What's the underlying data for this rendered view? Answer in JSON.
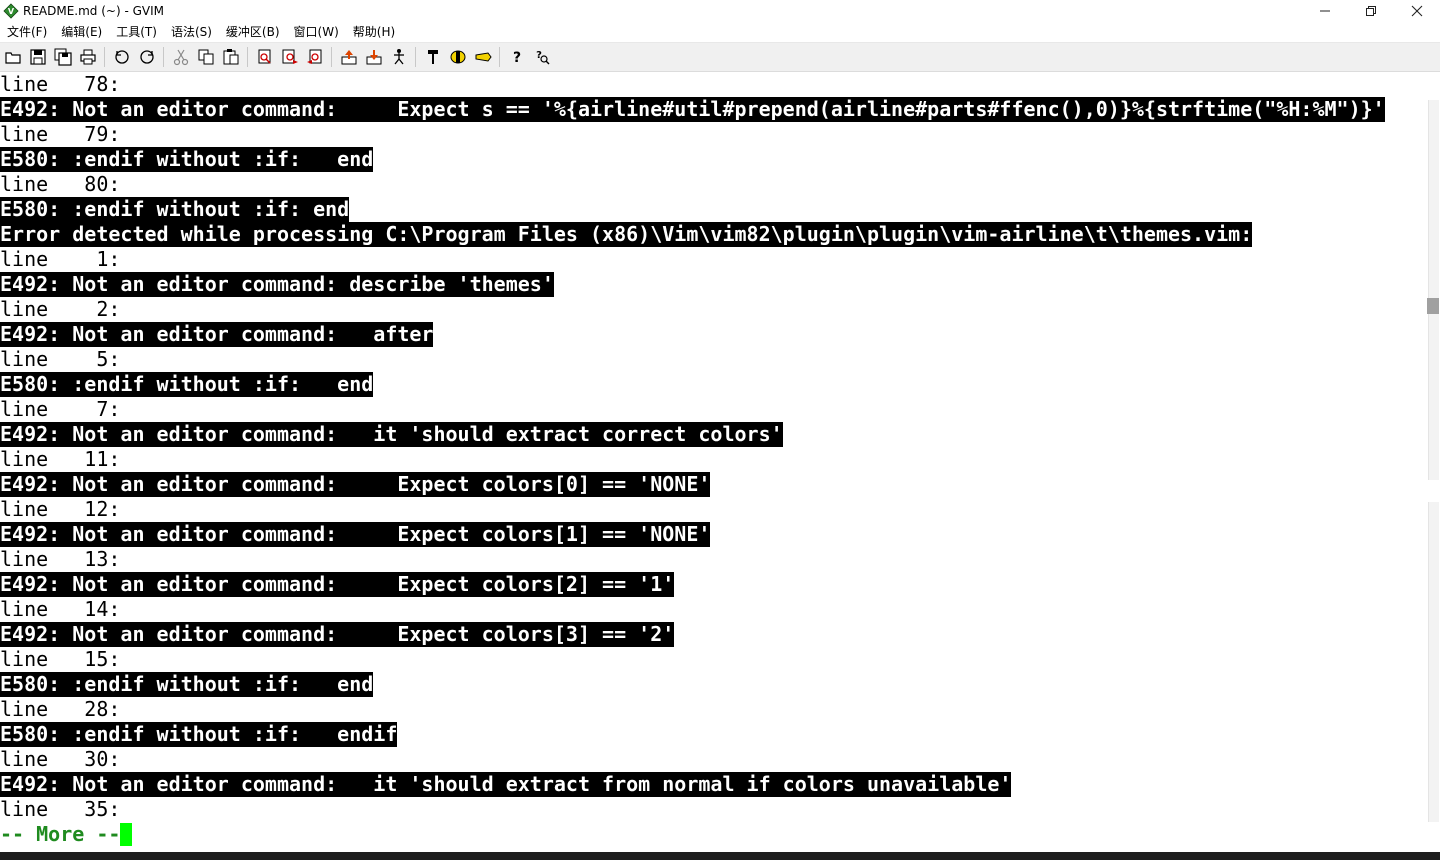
{
  "window": {
    "title": "README.md (~) - GVIM",
    "controls": {
      "minimize": "—",
      "maximize": "❐",
      "close": "✕"
    }
  },
  "menu": [
    "文件(F)",
    "编辑(E)",
    "工具(T)",
    "语法(S)",
    "缓冲区(B)",
    "窗口(W)",
    "帮助(H)"
  ],
  "toolbar": {
    "icons": [
      "open-icon",
      "save-icon",
      "save-all-icon",
      "print-icon",
      "undo-icon",
      "redo-icon",
      "cut-icon",
      "copy-icon",
      "paste-icon",
      "find-replace-icon",
      "find-next-icon",
      "find-prev-icon",
      "load-session-icon",
      "save-session-icon",
      "run-script-icon",
      "make-icon",
      "shell-icon",
      "tags-icon",
      "help-icon",
      "find-help-icon"
    ]
  },
  "editor": {
    "lines": [
      {
        "kind": "info",
        "text": "line   78:"
      },
      {
        "kind": "error",
        "text": "E492: Not an editor command:     Expect s == '%{airline#util#prepend(airline#parts#ffenc(),0)}%{strftime(\"%H:%M\")}'"
      },
      {
        "kind": "info",
        "text": "line   79:"
      },
      {
        "kind": "error",
        "text": "E580: :endif without :if:   end"
      },
      {
        "kind": "info",
        "text": "line   80:"
      },
      {
        "kind": "error",
        "text": "E580: :endif without :if: end"
      },
      {
        "kind": "error",
        "text": "Error detected while processing C:\\Program Files (x86)\\Vim\\vim82\\plugin\\plugin\\vim-airline\\t\\themes.vim:"
      },
      {
        "kind": "info",
        "text": "line    1:"
      },
      {
        "kind": "error",
        "text": "E492: Not an editor command: describe 'themes'"
      },
      {
        "kind": "info",
        "text": "line    2:"
      },
      {
        "kind": "error",
        "text": "E492: Not an editor command:   after"
      },
      {
        "kind": "info",
        "text": "line    5:"
      },
      {
        "kind": "error",
        "text": "E580: :endif without :if:   end"
      },
      {
        "kind": "info",
        "text": "line    7:"
      },
      {
        "kind": "error",
        "text": "E492: Not an editor command:   it 'should extract correct colors'"
      },
      {
        "kind": "info",
        "text": "line   11:"
      },
      {
        "kind": "error",
        "text": "E492: Not an editor command:     Expect colors[0] == 'NONE'"
      },
      {
        "kind": "info",
        "text": "line   12:"
      },
      {
        "kind": "error",
        "text": "E492: Not an editor command:     Expect colors[1] == 'NONE'"
      },
      {
        "kind": "info",
        "text": "line   13:"
      },
      {
        "kind": "error",
        "text": "E492: Not an editor command:     Expect colors[2] == '1'"
      },
      {
        "kind": "info",
        "text": "line   14:"
      },
      {
        "kind": "error",
        "text": "E492: Not an editor command:     Expect colors[3] == '2'"
      },
      {
        "kind": "info",
        "text": "line   15:"
      },
      {
        "kind": "error",
        "text": "E580: :endif without :if:   end"
      },
      {
        "kind": "info",
        "text": "line   28:"
      },
      {
        "kind": "error",
        "text": "E580: :endif without :if:   endif"
      },
      {
        "kind": "info",
        "text": "line   30:"
      },
      {
        "kind": "error",
        "text": "E492: Not an editor command:   it 'should extract from normal if colors unavailable'"
      },
      {
        "kind": "info",
        "text": "line   35:"
      }
    ],
    "more_prompt": "-- More --"
  },
  "colors": {
    "error_bg": "#000000",
    "error_fg": "#ffffff",
    "more_fg": "#1f8b1f",
    "cursor": "#00ff00"
  }
}
